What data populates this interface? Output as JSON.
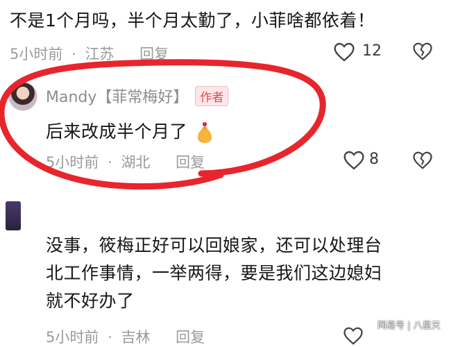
{
  "comments": [
    {
      "text": "不是1个月吗，半个月太勤了，小菲啥都依着！",
      "time": "5小时前",
      "location": "江苏",
      "reply_label": "回复",
      "likes": "12"
    },
    {
      "author": "Mandy【菲常梅好】",
      "badge": "作者",
      "text": "后来改成半个月了",
      "time": "5小时前",
      "location": "湖北",
      "reply_label": "回复",
      "likes": "8"
    },
    {
      "text_lines": [
        "没事，筱梅正好可以回娘家，还可以处理台",
        "北工作事情，一举两得，要是我们这边媳妇",
        "就不好办了"
      ],
      "time": "5小时前",
      "location": "吉林",
      "reply_label": "回复"
    }
  ],
  "separator": "·",
  "watermark": "网易号 | 八星天",
  "colors": {
    "annotation": "#e8252c",
    "author_badge": "#e5474f"
  }
}
